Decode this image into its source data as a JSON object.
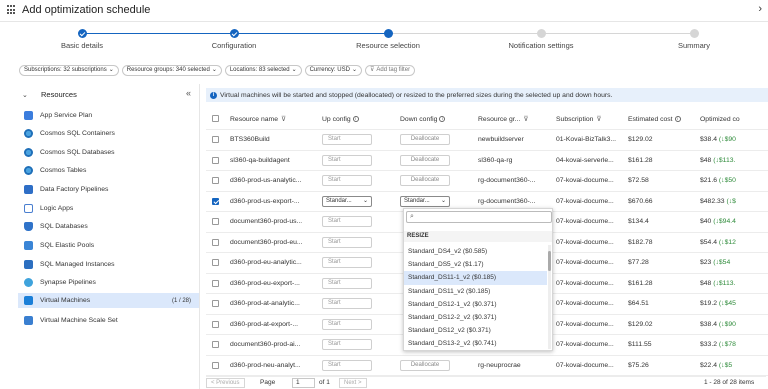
{
  "header": {
    "title": "Add optimization schedule"
  },
  "stepper": {
    "steps": [
      {
        "label": "Basic details",
        "state": "done"
      },
      {
        "label": "Configuration",
        "state": "done"
      },
      {
        "label": "Resource selection",
        "state": "current"
      },
      {
        "label": "Notification settings",
        "state": "todo"
      },
      {
        "label": "Summary",
        "state": "todo"
      }
    ]
  },
  "filters": {
    "subscriptions": "Subscriptions: 32 subscriptions",
    "resource_groups": "Resource groups: 340 selected",
    "locations": "Locations: 83 selected",
    "currency": "Currency: USD",
    "add_tag": "Add tag filter"
  },
  "sidebar": {
    "title": "Resources",
    "items": [
      {
        "label": "App Service Plan",
        "icon": "app-service-icon"
      },
      {
        "label": "Cosmos SQL Containers",
        "icon": "cosmos-icon"
      },
      {
        "label": "Cosmos SQL Databases",
        "icon": "cosmos-icon"
      },
      {
        "label": "Cosmos Tables",
        "icon": "cosmos-icon"
      },
      {
        "label": "Data Factory Pipelines",
        "icon": "data-factory-icon"
      },
      {
        "label": "Logic Apps",
        "icon": "logic-apps-icon"
      },
      {
        "label": "SQL Databases",
        "icon": "sql-database-icon"
      },
      {
        "label": "SQL Elastic Pools",
        "icon": "sql-pool-icon"
      },
      {
        "label": "SQL Managed Instances",
        "icon": "sql-mi-icon"
      },
      {
        "label": "Synapse Pipelines",
        "icon": "synapse-icon"
      },
      {
        "label": "Virtual Machines",
        "icon": "vm-icon",
        "count": "(1 / 28)",
        "active": true
      },
      {
        "label": "Virtual Machine Scale Set",
        "icon": "vmss-icon"
      }
    ]
  },
  "info_banner": "Virtual machines will be started and stopped (deallocated) or resized to the preferred sizes during the selected up and down hours.",
  "table": {
    "headers": [
      "Resource name",
      "Up config",
      "Down config",
      "Resource gr...",
      "Subscription",
      "Estimated cost",
      "Optimized co"
    ],
    "rows": [
      {
        "checked": false,
        "name": "BTS360Build",
        "up": "Start",
        "down": "Deallocate",
        "rg": "newbuildserver",
        "sub": "01-Kovai-BizTalk3...",
        "cost": "$129.02",
        "opt": "$38.4",
        "save": "(↓$90"
      },
      {
        "checked": false,
        "name": "sl360-qa-buildagent",
        "up": "Start",
        "down": "Deallocate",
        "rg": "sl360-qa-rg",
        "sub": "04-kovai-serverle...",
        "cost": "$161.28",
        "opt": "$48",
        "save": "(↓$113."
      },
      {
        "checked": false,
        "name": "d360-prod-us-analytic...",
        "up": "Start",
        "down": "Deallocate",
        "rg": "rg-document360-...",
        "sub": "07-kovai-docume...",
        "cost": "$72.58",
        "opt": "$21.6",
        "save": "(↓$50"
      },
      {
        "checked": true,
        "name": "d360-prod-us-export-...",
        "up": "Standar...",
        "down": "Standar...",
        "rg": "rg-document360-...",
        "sub": "07-kovai-docume...",
        "cost": "$670.66",
        "opt": "$482.33",
        "save": "(↓$"
      },
      {
        "checked": false,
        "name": "document360-prod-us...",
        "up": "Start",
        "down": "",
        "rg": "",
        "sub": "07-kovai-docume...",
        "cost": "$134.4",
        "opt": "$40",
        "save": "(↓$94.4"
      },
      {
        "checked": false,
        "name": "document360-prod-eu...",
        "up": "Start",
        "down": "",
        "rg": "",
        "sub": "07-kovai-docume...",
        "cost": "$182.78",
        "opt": "$54.4",
        "save": "(↓$12"
      },
      {
        "checked": false,
        "name": "d360-prod-eu-analytic...",
        "up": "Start",
        "down": "",
        "rg": "",
        "sub": "07-kovai-docume...",
        "cost": "$77.28",
        "opt": "$23",
        "save": "(↓$54"
      },
      {
        "checked": false,
        "name": "d360-prod-eu-export-...",
        "up": "Start",
        "down": "",
        "rg": "",
        "sub": "07-kovai-docume...",
        "cost": "$161.28",
        "opt": "$48",
        "save": "(↓$113."
      },
      {
        "checked": false,
        "name": "d360-prod-at-analytic...",
        "up": "Start",
        "down": "",
        "rg": "",
        "sub": "07-kovai-docume...",
        "cost": "$64.51",
        "opt": "$19.2",
        "save": "(↓$45"
      },
      {
        "checked": false,
        "name": "d360-prod-at-export-...",
        "up": "Start",
        "down": "",
        "rg": "",
        "sub": "07-kovai-docume...",
        "cost": "$129.02",
        "opt": "$38.4",
        "save": "(↓$90"
      },
      {
        "checked": false,
        "name": "document360-prod-ai...",
        "up": "Start",
        "down": "",
        "rg": "",
        "sub": "07-kovai-docume...",
        "cost": "$111.55",
        "opt": "$33.2",
        "save": "(↓$78"
      },
      {
        "checked": false,
        "name": "d360-prod-neu-analyt...",
        "up": "Start",
        "down": "Deallocate",
        "rg": "rg-neuprocrae",
        "sub": "07-kovai-docume...",
        "cost": "$75.26",
        "opt": "$22.4",
        "save": "(↓$5"
      }
    ]
  },
  "dropdown": {
    "search_placeholder": "",
    "group_label": "RESIZE",
    "options": [
      "Standard_DS4_v2 ($0.585)",
      "Standard_DS5_v2 ($1.17)",
      "Standard_DS11-1_v2 ($0.185)",
      "Standard_DS11_v2 ($0.185)",
      "Standard_DS12-1_v2 ($0.371)",
      "Standard_DS12-2_v2 ($0.371)",
      "Standard_DS12_v2 ($0.371)",
      "Standard_DS13-2_v2 ($0.741)"
    ],
    "highlighted_index": 2
  },
  "pager": {
    "previous": "< Previous",
    "page_label": "Page",
    "page_value": "1",
    "of_label": "of 1",
    "next": "Next >",
    "summary": "1 - 28 of 28 items"
  },
  "colors": {
    "accent": "#1565c0",
    "active_bg": "#dbe8fb",
    "info_bg": "#e7f0fb",
    "saving_green": "#2e8b3a"
  }
}
